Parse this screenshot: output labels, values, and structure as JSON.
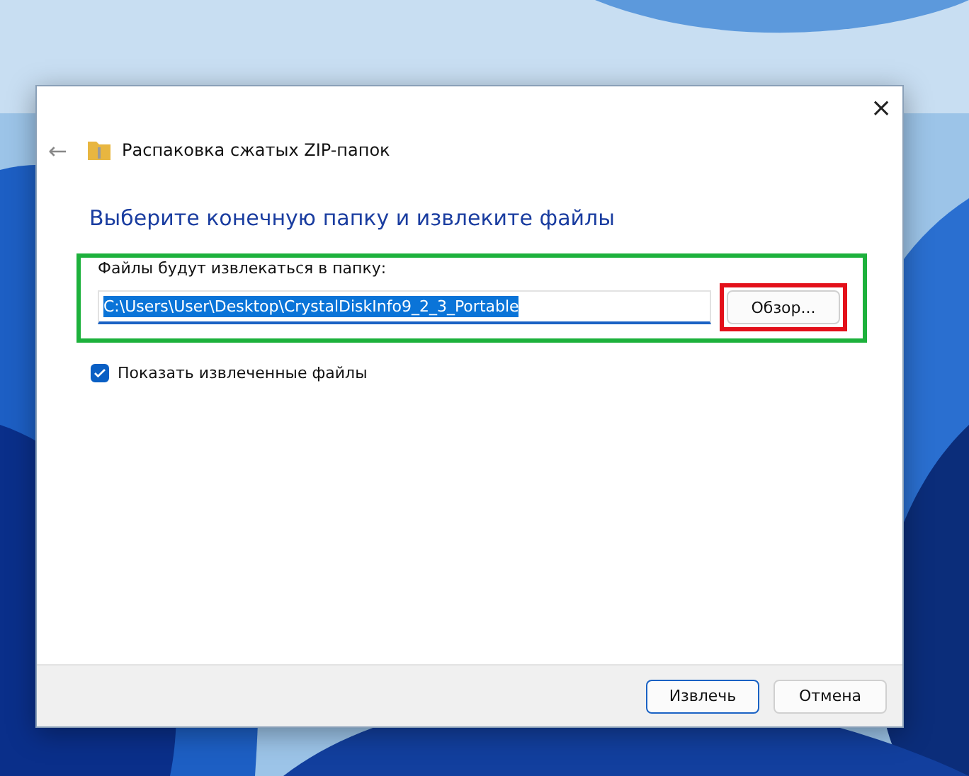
{
  "window": {
    "title": "Распаковка сжатых ZIP-папок",
    "close": "×",
    "back": "←"
  },
  "heading": "Выберите конечную папку и извлеките файлы",
  "destination": {
    "label": "Файлы будут извлекаться в папку:",
    "value": "C:\\Users\\User\\Desktop\\CrystalDiskInfo9_2_3_Portable",
    "highlight": {
      "color": "#1db13c"
    },
    "browse": {
      "label": "Обзор...",
      "highlight": {
        "color": "#e3101a"
      }
    }
  },
  "show_files": {
    "label": "Показать извлеченные файлы",
    "checked": true
  },
  "buttons": [
    {
      "label": "Извлечь",
      "default": true
    },
    {
      "label": "Отмена",
      "default": false
    }
  ]
}
